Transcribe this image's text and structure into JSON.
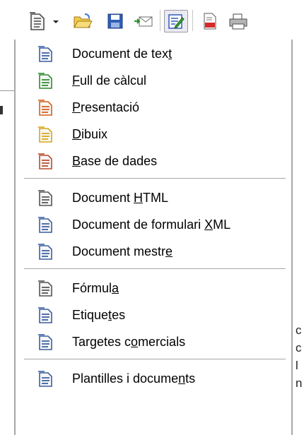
{
  "toolbar": {
    "buttons": [
      {
        "name": "new-document-icon",
        "pressed": false
      },
      {
        "name": "open-folder-icon",
        "pressed": false
      },
      {
        "name": "save-disk-icon",
        "pressed": false
      },
      {
        "name": "email-icon",
        "pressed": false
      },
      {
        "name": "edit-file-icon",
        "pressed": true
      },
      {
        "name": "export-pdf-icon",
        "pressed": false
      },
      {
        "name": "print-icon",
        "pressed": false
      }
    ],
    "dropdown_icon": "arrow-down-icon"
  },
  "menu": {
    "groups": [
      [
        {
          "label": "Document de text",
          "accel": "t",
          "icon": "writer-document-icon",
          "color": "#3a5fa0"
        },
        {
          "label": "Full de càlcul",
          "accel": "F",
          "icon": "calc-spreadsheet-icon",
          "color": "#2e8b2e"
        },
        {
          "label": "Presentació",
          "accel": "P",
          "icon": "impress-presentation-icon",
          "color": "#d8601a"
        },
        {
          "label": "Dibuix",
          "accel": "D",
          "icon": "draw-drawing-icon",
          "color": "#d9a51a"
        },
        {
          "label": "Base de dades",
          "accel": "B",
          "icon": "base-database-icon",
          "color": "#b84d2e"
        }
      ],
      [
        {
          "label": "Document HTML",
          "accel": "H",
          "icon": "html-document-icon",
          "color": "#555555"
        },
        {
          "label": "Document de formulari XML",
          "accel": "X",
          "icon": "xml-form-document-icon",
          "color": "#3a5fa0"
        },
        {
          "label": "Document mestre",
          "accel": "e",
          "icon": "master-document-icon",
          "color": "#3a5fa0"
        }
      ],
      [
        {
          "label": "Fórmula",
          "accel": "a",
          "icon": "math-formula-icon",
          "color": "#555555"
        },
        {
          "label": "Etiquetes",
          "accel": "t",
          "icon": "labels-icon",
          "color": "#3a5fa0"
        },
        {
          "label": "Targetes comercials",
          "accel": "o",
          "icon": "business-cards-icon",
          "color": "#3a5fa0"
        }
      ],
      [
        {
          "label": "Plantilles i documents",
          "accel": "n",
          "icon": "templates-icon",
          "color": "#3a5fa0"
        }
      ]
    ]
  },
  "background": {
    "right_chars": [
      "c",
      "c",
      "l",
      "n"
    ]
  }
}
